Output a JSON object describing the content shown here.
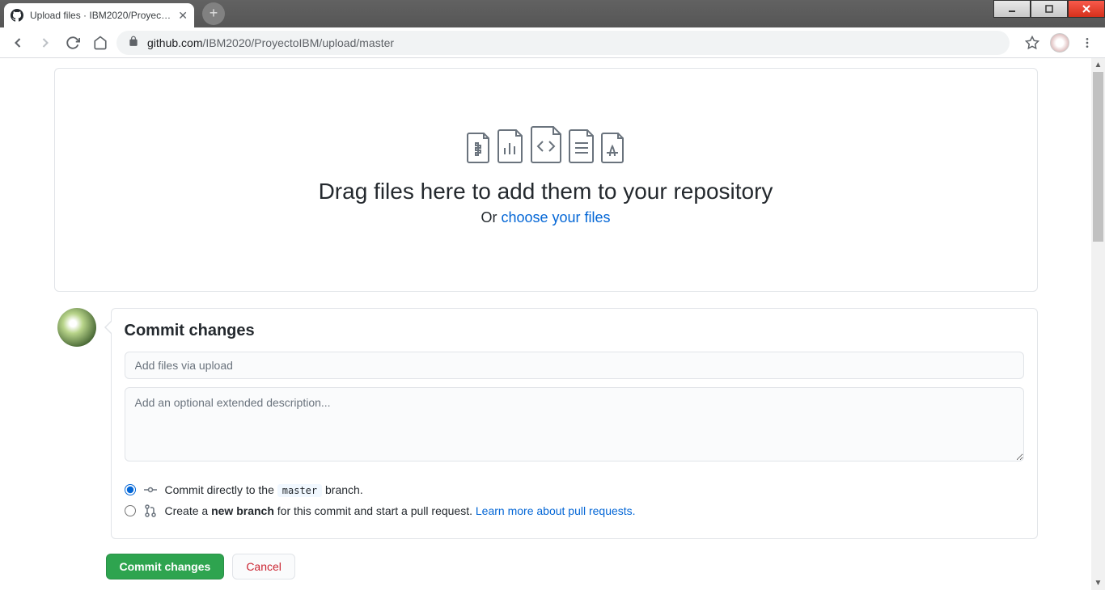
{
  "browser": {
    "tab_title": "Upload files · IBM2020/ProyectoI",
    "url_host": "github.com",
    "url_path": "/IBM2020/ProyectoIBM/upload/master"
  },
  "dropzone": {
    "heading": "Drag files here to add them to your repository",
    "or_text": "Or ",
    "choose_link": "choose your files"
  },
  "commit": {
    "heading": "Commit changes",
    "summary_placeholder": "Add files via upload",
    "description_placeholder": "Add an optional extended description...",
    "radio_direct_prefix": "Commit directly to the ",
    "radio_direct_branch": "master",
    "radio_direct_suffix": " branch.",
    "radio_newbranch_prefix": "Create a ",
    "radio_newbranch_bold": "new branch",
    "radio_newbranch_suffix": " for this commit and start a pull request. ",
    "radio_newbranch_link": "Learn more about pull requests."
  },
  "buttons": {
    "commit": "Commit changes",
    "cancel": "Cancel"
  }
}
